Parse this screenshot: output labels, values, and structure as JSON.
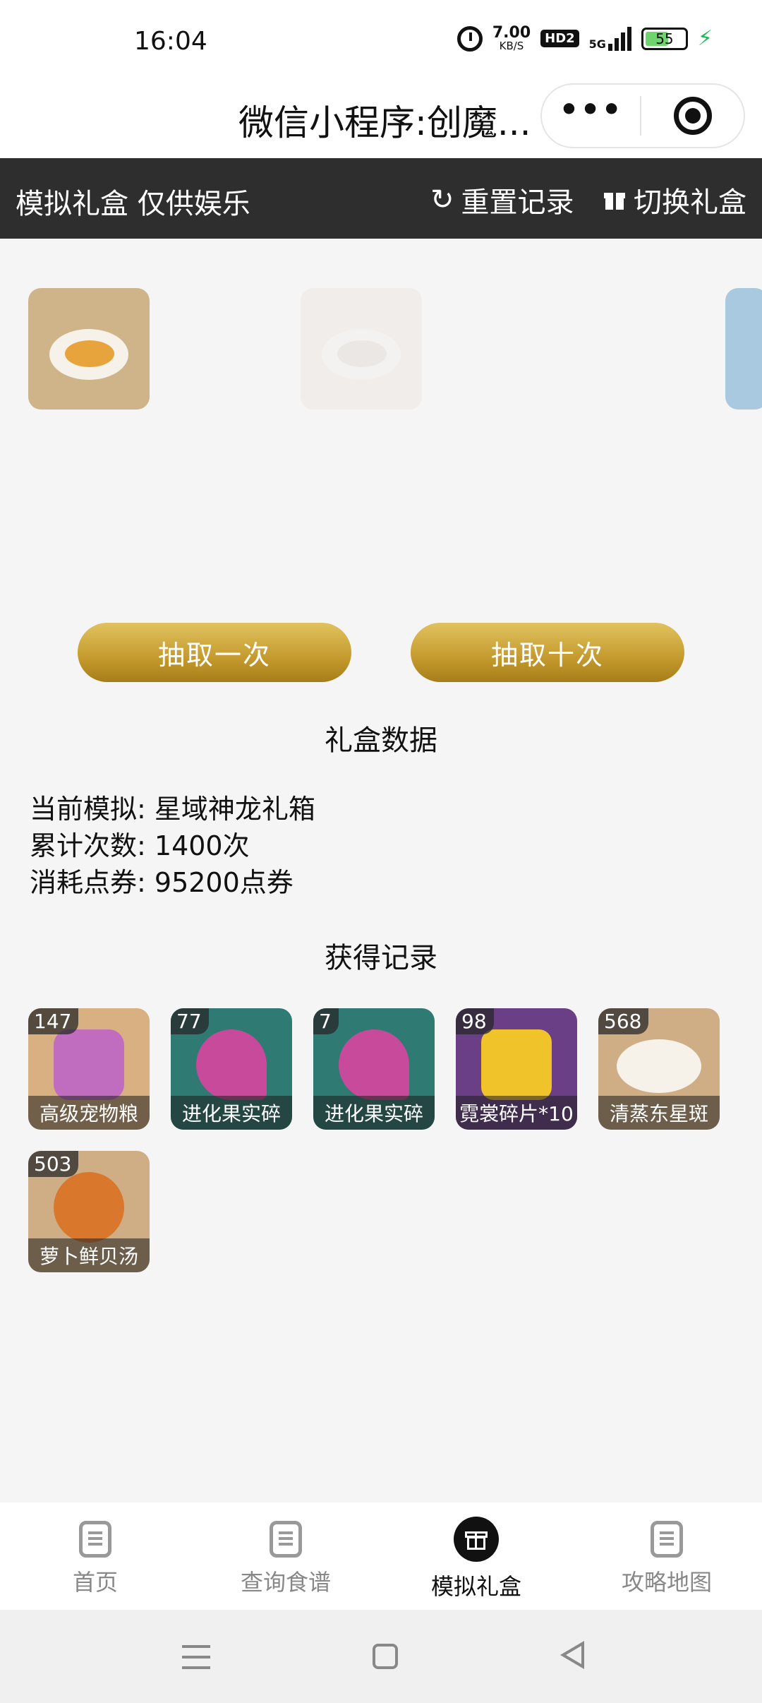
{
  "status": {
    "time": "16:04",
    "net_speed_value": "7.00",
    "net_speed_unit": "KB/S",
    "hd_badge": "HD2",
    "signal_label": "5G",
    "battery": "55"
  },
  "navbar": {
    "title": "微信小程序:创魔...",
    "more": "•••"
  },
  "header": {
    "left_text": "模拟礼盒 仅供娱乐",
    "reset_label": "重置记录",
    "switch_label": "切换礼盒"
  },
  "buttons": {
    "draw_one": "抽取一次",
    "draw_ten": "抽取十次"
  },
  "stats": {
    "section_title": "礼盒数据",
    "current_label": "当前模拟:",
    "current_value": "星域神龙礼箱",
    "count_label": "累计次数:",
    "count_value": "1400次",
    "cost_label": "消耗点券:",
    "cost_value": "95200点券"
  },
  "records": {
    "section_title": "获得记录",
    "items": [
      {
        "count": "147",
        "name": "高级宠物粮"
      },
      {
        "count": "77",
        "name": "进化果实碎"
      },
      {
        "count": "7",
        "name": "进化果实碎"
      },
      {
        "count": "98",
        "name": "霓裳碎片*10"
      },
      {
        "count": "568",
        "name": "清蒸东星斑"
      },
      {
        "count": "503",
        "name": "萝卜鲜贝汤"
      }
    ]
  },
  "tabbar": {
    "tabs": [
      {
        "label": "首页",
        "icon": "document-icon"
      },
      {
        "label": "查询食谱",
        "icon": "document-icon"
      },
      {
        "label": "模拟礼盒",
        "icon": "gift-icon"
      },
      {
        "label": "攻略地图",
        "icon": "document-icon"
      }
    ],
    "active": "模拟礼盒"
  },
  "colors": {
    "header_bg": "#2e2e2e",
    "button_gold": "#c49a2d",
    "page_bg": "#f5f5f5"
  }
}
